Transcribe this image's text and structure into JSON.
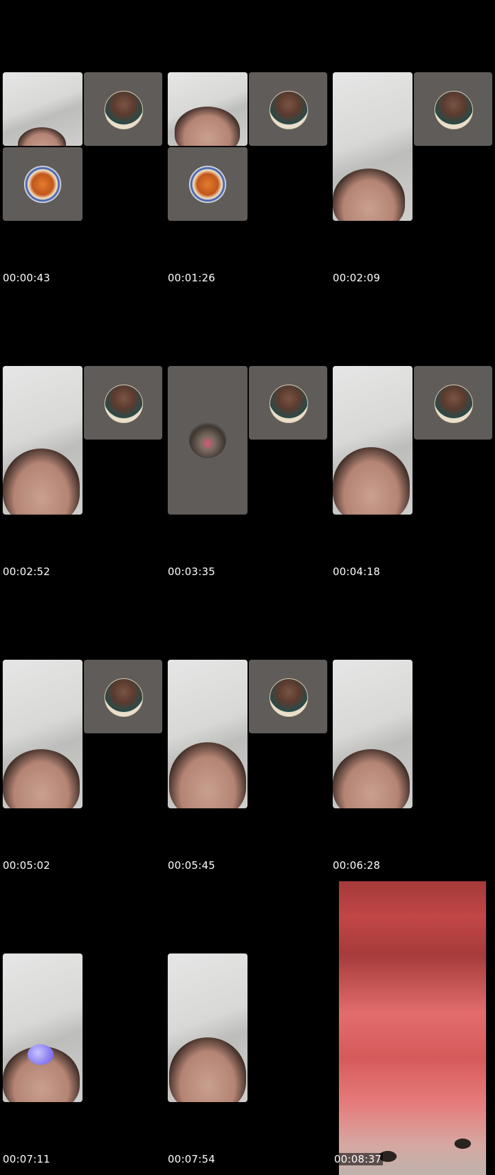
{
  "timestamps": [
    "00:00:43",
    "00:01:26",
    "00:02:09",
    "00:02:52",
    "00:03:35",
    "00:04:18",
    "00:05:02",
    "00:05:45",
    "00:06:28",
    "00:07:11",
    "00:07:54",
    "00:08:37"
  ],
  "colors": {
    "background": "#000000",
    "tile_gray": "#605c59",
    "timestamp_text": "#ffffff"
  }
}
